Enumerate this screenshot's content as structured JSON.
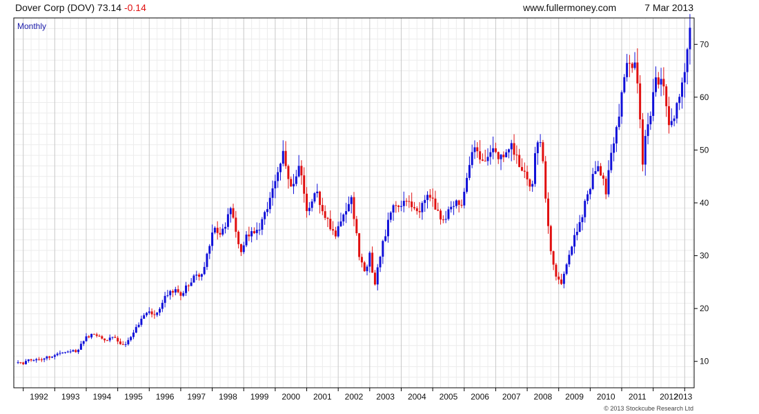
{
  "header": {
    "name": "Dover Corp (DOV)",
    "price": "73.14",
    "change": "-0.14",
    "site": "www.fullermoney.com",
    "date": "7 Mar 2013"
  },
  "period_label": "Monthly",
  "copyright": "© 2013 Stockcube Research Ltd",
  "colors": {
    "up": "#1010d8",
    "down": "#e01010",
    "grid": "#d8d8d8",
    "change": "#e01010",
    "period": "#1a1aa8"
  },
  "chart_data": {
    "type": "candlestick",
    "title": "Dover Corp (DOV)",
    "interval": "Monthly",
    "x_range": [
      1991.7,
      2013.3
    ],
    "ylim": [
      5,
      75
    ],
    "y_ticks": [
      10,
      20,
      30,
      40,
      50,
      60,
      70
    ],
    "x_tick_labels": [
      "1992",
      "1993",
      "1994",
      "1995",
      "1996",
      "1997",
      "1998",
      "1999",
      "2000",
      "2001",
      "2002",
      "2003",
      "2004",
      "2005",
      "2006",
      "2007",
      "2008",
      "2009",
      "2010",
      "2011",
      "2012",
      "2013"
    ],
    "grid": true,
    "close_path": [
      {
        "t": 1991.75,
        "c": 9.8
      },
      {
        "t": 1992.0,
        "c": 9.6
      },
      {
        "t": 1992.2,
        "c": 10.4
      },
      {
        "t": 1992.5,
        "c": 10.3
      },
      {
        "t": 1992.9,
        "c": 11.0
      },
      {
        "t": 1993.3,
        "c": 11.8
      },
      {
        "t": 1993.7,
        "c": 12.0
      },
      {
        "t": 1994.0,
        "c": 14.5
      },
      {
        "t": 1994.2,
        "c": 15.3
      },
      {
        "t": 1994.4,
        "c": 15.0
      },
      {
        "t": 1994.6,
        "c": 14.0
      },
      {
        "t": 1994.9,
        "c": 14.6
      },
      {
        "t": 1995.0,
        "c": 13.8
      },
      {
        "t": 1995.2,
        "c": 13.0
      },
      {
        "t": 1995.5,
        "c": 15.5
      },
      {
        "t": 1995.9,
        "c": 19.5
      },
      {
        "t": 1996.2,
        "c": 18.5
      },
      {
        "t": 1996.5,
        "c": 22.5
      },
      {
        "t": 1996.8,
        "c": 23.5
      },
      {
        "t": 1997.0,
        "c": 22.5
      },
      {
        "t": 1997.4,
        "c": 26.0
      },
      {
        "t": 1997.7,
        "c": 26.0
      },
      {
        "t": 1998.0,
        "c": 35.0
      },
      {
        "t": 1998.3,
        "c": 34.5
      },
      {
        "t": 1998.6,
        "c": 38.5
      },
      {
        "t": 1998.9,
        "c": 31.0
      },
      {
        "t": 1999.1,
        "c": 34.0
      },
      {
        "t": 1999.4,
        "c": 34.0
      },
      {
        "t": 1999.7,
        "c": 38.0
      },
      {
        "t": 2000.0,
        "c": 44.0
      },
      {
        "t": 2000.25,
        "c": 49.0
      },
      {
        "t": 2000.5,
        "c": 43.0
      },
      {
        "t": 2000.75,
        "c": 47.0
      },
      {
        "t": 2001.0,
        "c": 39.0
      },
      {
        "t": 2001.3,
        "c": 42.0
      },
      {
        "t": 2001.6,
        "c": 37.0
      },
      {
        "t": 2001.9,
        "c": 34.0
      },
      {
        "t": 2002.15,
        "c": 38.0
      },
      {
        "t": 2002.4,
        "c": 41.0
      },
      {
        "t": 2002.7,
        "c": 29.0
      },
      {
        "t": 2002.85,
        "c": 27.0
      },
      {
        "t": 2003.0,
        "c": 30.0
      },
      {
        "t": 2003.15,
        "c": 24.5
      },
      {
        "t": 2003.4,
        "c": 32.0
      },
      {
        "t": 2003.7,
        "c": 39.0
      },
      {
        "t": 2004.0,
        "c": 39.5
      },
      {
        "t": 2004.3,
        "c": 40.0
      },
      {
        "t": 2004.6,
        "c": 38.5
      },
      {
        "t": 2004.9,
        "c": 42.0
      },
      {
        "t": 2005.1,
        "c": 38.0
      },
      {
        "t": 2005.4,
        "c": 37.0
      },
      {
        "t": 2005.7,
        "c": 40.5
      },
      {
        "t": 2005.95,
        "c": 39.5
      },
      {
        "t": 2006.1,
        "c": 45.0
      },
      {
        "t": 2006.3,
        "c": 50.0
      },
      {
        "t": 2006.6,
        "c": 48.0
      },
      {
        "t": 2006.9,
        "c": 49.5
      },
      {
        "t": 2007.2,
        "c": 48.0
      },
      {
        "t": 2007.5,
        "c": 51.0
      },
      {
        "t": 2007.8,
        "c": 47.0
      },
      {
        "t": 2008.0,
        "c": 44.0
      },
      {
        "t": 2008.15,
        "c": 42.0
      },
      {
        "t": 2008.3,
        "c": 52.0
      },
      {
        "t": 2008.45,
        "c": 50.5
      },
      {
        "t": 2008.6,
        "c": 40.0
      },
      {
        "t": 2008.75,
        "c": 31.0
      },
      {
        "t": 2008.9,
        "c": 26.0
      },
      {
        "t": 2009.05,
        "c": 24.5
      },
      {
        "t": 2009.15,
        "c": 26.0
      },
      {
        "t": 2009.4,
        "c": 32.0
      },
      {
        "t": 2009.7,
        "c": 37.0
      },
      {
        "t": 2009.95,
        "c": 42.0
      },
      {
        "t": 2010.2,
        "c": 47.0
      },
      {
        "t": 2010.35,
        "c": 46.0
      },
      {
        "t": 2010.5,
        "c": 42.0
      },
      {
        "t": 2010.7,
        "c": 50.0
      },
      {
        "t": 2010.9,
        "c": 56.0
      },
      {
        "t": 2011.0,
        "c": 60.0
      },
      {
        "t": 2011.15,
        "c": 65.5
      },
      {
        "t": 2011.3,
        "c": 67.0
      },
      {
        "t": 2011.45,
        "c": 66.0
      },
      {
        "t": 2011.55,
        "c": 60.0
      },
      {
        "t": 2011.65,
        "c": 47.0
      },
      {
        "t": 2011.8,
        "c": 55.0
      },
      {
        "t": 2011.95,
        "c": 58.0
      },
      {
        "t": 2012.1,
        "c": 63.5
      },
      {
        "t": 2012.25,
        "c": 63.0
      },
      {
        "t": 2012.4,
        "c": 60.0
      },
      {
        "t": 2012.55,
        "c": 53.5
      },
      {
        "t": 2012.7,
        "c": 58.0
      },
      {
        "t": 2012.85,
        "c": 60.0
      },
      {
        "t": 2013.0,
        "c": 66.0
      },
      {
        "t": 2013.1,
        "c": 69.0
      },
      {
        "t": 2013.19,
        "c": 73.14
      }
    ]
  }
}
